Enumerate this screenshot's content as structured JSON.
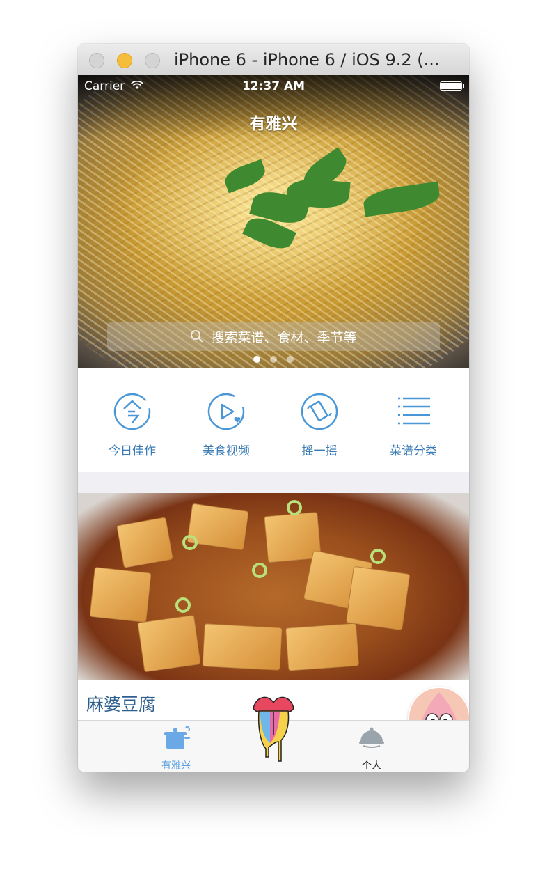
{
  "window": {
    "title": "iPhone 6 - iPhone 6 / iOS 9.2 (..."
  },
  "status_bar": {
    "carrier": "Carrier",
    "time": "12:37 AM"
  },
  "nav": {
    "title": "有雅兴"
  },
  "search": {
    "placeholder": "搜索菜谱、食材、季节等"
  },
  "carousel": {
    "pages": 3,
    "active": 1
  },
  "shortcuts": [
    {
      "label": "今日佳作",
      "icon": "today-icon"
    },
    {
      "label": "美食视频",
      "icon": "video-icon"
    },
    {
      "label": "摇一摇",
      "icon": "shake-icon"
    },
    {
      "label": "菜谱分类",
      "icon": "list-icon"
    }
  ],
  "recipe": {
    "title": "麻婆豆腐"
  },
  "tabbar": {
    "items": [
      {
        "label": "有雅兴",
        "icon": "pot-icon",
        "active": true
      },
      {
        "label": "个人",
        "icon": "cloche-icon",
        "active": false
      }
    ]
  },
  "colors": {
    "accent": "#5aa0e0",
    "link_text": "#3a7bb5",
    "recipe_title": "#2e5f8e"
  }
}
